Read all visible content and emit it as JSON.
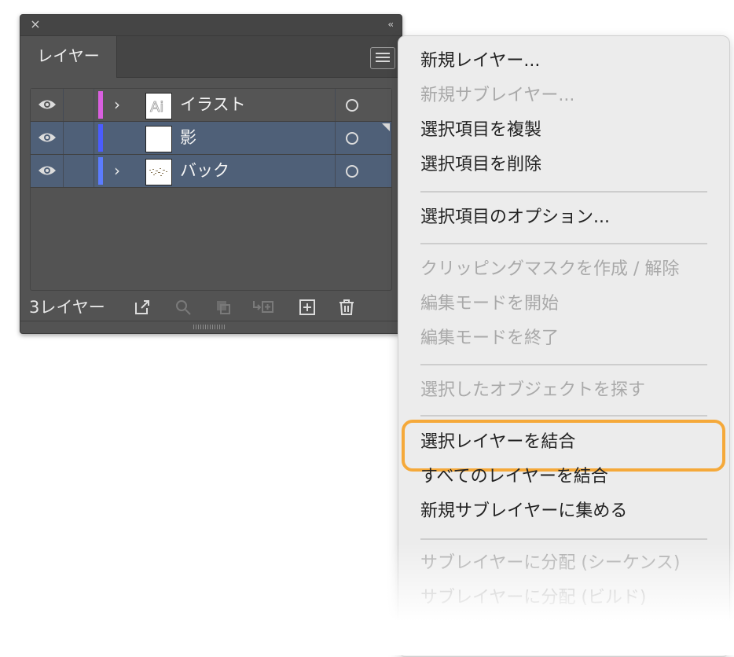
{
  "panel": {
    "close_icon": "×",
    "collapse_icon": "‹‹",
    "tab_label": "レイヤー",
    "menu_icon": "hamburger-icon",
    "layers": [
      {
        "name": "イラスト",
        "color": "#d95fe0",
        "selected": false,
        "expandable": true,
        "thumb": "Ai"
      },
      {
        "name": "影",
        "color": "#4a5cff",
        "selected": true,
        "expandable": false,
        "thumb": ""
      },
      {
        "name": "バック",
        "color": "#5b7cff",
        "selected": true,
        "expandable": true,
        "thumb": "pattern"
      }
    ],
    "chevron": "›",
    "footer_count": "3レイヤー"
  },
  "menu": {
    "items": [
      {
        "label": "新規レイヤー...",
        "enabled": true
      },
      {
        "label": "新規サブレイヤー...",
        "enabled": false
      },
      {
        "label": "選択項目を複製",
        "enabled": true
      },
      {
        "label": "選択項目を削除",
        "enabled": true
      },
      {
        "label": "選択項目のオプション...",
        "enabled": true
      },
      {
        "label": "クリッピングマスクを作成 / 解除",
        "enabled": false
      },
      {
        "label": "編集モードを開始",
        "enabled": false
      },
      {
        "label": "編集モードを終了",
        "enabled": false
      },
      {
        "label": "選択したオブジェクトを探す",
        "enabled": false
      },
      {
        "label": "選択レイヤーを結合",
        "enabled": true,
        "highlighted": true
      },
      {
        "label": "すべてのレイヤーを結合",
        "enabled": true
      },
      {
        "label": "新規サブレイヤーに集める",
        "enabled": true
      },
      {
        "label": "サブレイヤーに分配 (シーケンス)",
        "enabled": false
      },
      {
        "label": "サブレイヤーに分配 (ビルド)",
        "enabled": false
      }
    ],
    "highlight_color": "#f5a93a"
  }
}
